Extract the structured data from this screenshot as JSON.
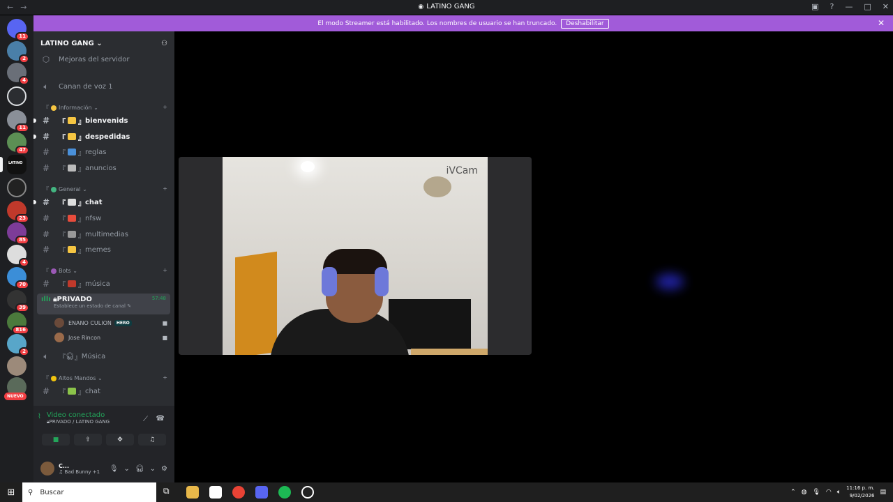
{
  "window": {
    "title": "LATINO GANG"
  },
  "banner": {
    "message": "El modo Streamer está habilitado. Los nombres de usuario se han truncado.",
    "disable_label": "Deshabilitar"
  },
  "server_rail": {
    "badges": [
      "11",
      "2",
      "4",
      "11",
      "47",
      "23",
      "85",
      "4",
      "70",
      "39",
      "816",
      "2"
    ],
    "nuevo_label": "NUEVO",
    "selected_label": "LATINO"
  },
  "sidebar": {
    "guild_name": "LATINO GANG",
    "top_items": [
      "Mejoras del servidor",
      "Canan de voz 1"
    ],
    "categories": [
      {
        "name": "Información",
        "channels": [
          "bienvenids",
          "despedidas",
          "reglas",
          "anuncios"
        ]
      },
      {
        "name": "General",
        "channels": [
          "chat",
          "nfsw",
          "multimedias",
          "memes"
        ]
      },
      {
        "name": "Bots",
        "channels": [
          "música"
        ]
      },
      {
        "name": "Altos Mandos",
        "channels": [
          "chat"
        ]
      }
    ],
    "voice": {
      "name": "PRIVADO",
      "timer": "57:48",
      "status": "Establece un estado de canal",
      "users": [
        {
          "name": "ENANO CULION",
          "tag": "HERO"
        },
        {
          "name": "Jose Rincon",
          "tag": ""
        }
      ]
    },
    "voice_channel_2": "Música"
  },
  "voice_panel": {
    "status": "Video conectado",
    "sub": "PRIVADO / LATINO GANG"
  },
  "user": {
    "name": "C...",
    "activity": "Bad Bunny +1"
  },
  "stage": {
    "watermark": "iVCam"
  },
  "taskbar": {
    "search_placeholder": "Buscar",
    "time": "11:16 p. m.",
    "date": "9/02/2026"
  },
  "colors": {
    "accent": "#a15bd9",
    "green": "#23a55a",
    "badge": "#f23f43"
  }
}
